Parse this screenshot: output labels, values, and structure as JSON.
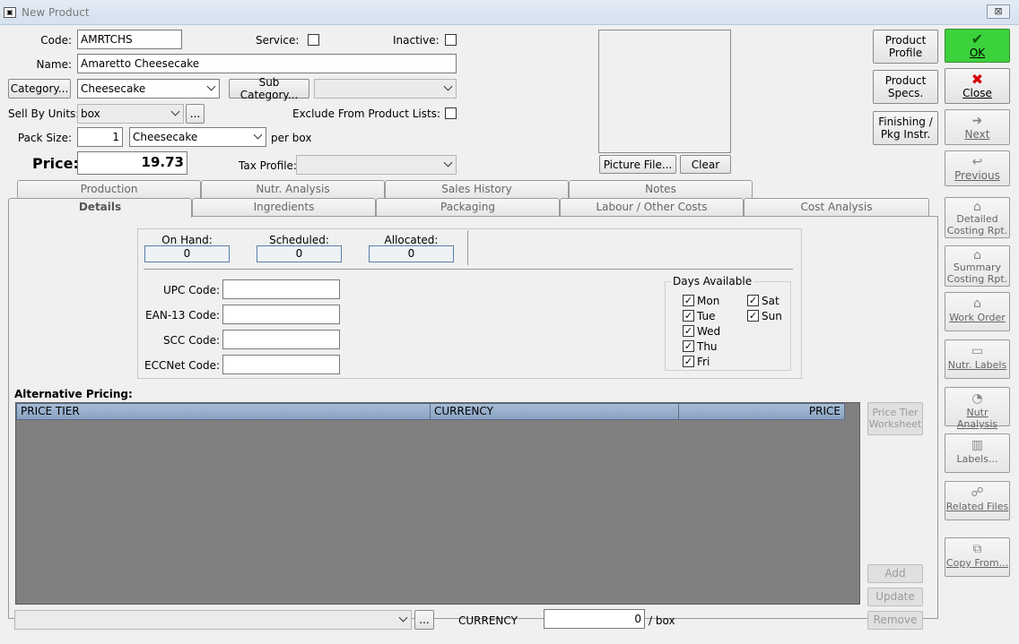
{
  "window": {
    "title": "New Product",
    "close_glyph": "⊠"
  },
  "form": {
    "code_label": "Code:",
    "code_value": "AMRTCHS",
    "service_label": "Service:",
    "inactive_label": "Inactive:",
    "name_label": "Name:",
    "name_value": "Amaretto Cheesecake",
    "category_button": "Category...",
    "category_value": "Cheesecake",
    "subcategory_button": "Sub Category...",
    "subcategory_value": "",
    "sell_by_label": "Sell By Units:",
    "sell_by_value": "box",
    "ellipsis": "...",
    "exclude_label": "Exclude From Product Lists:",
    "pack_size_label": "Pack Size:",
    "pack_size_value": "1",
    "pack_unit_value": "Cheesecake",
    "per_box": "per box",
    "price_label": "Price:",
    "price_value": "19.73",
    "tax_label": "Tax Profile:",
    "tax_value": ""
  },
  "picture": {
    "file_button": "Picture File...",
    "clear_button": "Clear"
  },
  "side_top": {
    "product_profile": [
      "Product",
      "Profile"
    ],
    "product_specs": [
      "Product",
      "Specs."
    ],
    "finishing": [
      "Finishing /",
      "Pkg Instr."
    ]
  },
  "actions": {
    "ok": "OK",
    "close": "Close",
    "next": "Next",
    "previous": "Previous",
    "detailed": [
      "Detailed",
      "Costing Rpt."
    ],
    "summary": [
      "Summary",
      "Costing Rpt."
    ],
    "work_order": "Work Order",
    "nutr_labels": "Nutr. Labels",
    "nutr_analysis": "Nutr Analysis",
    "labels": "Labels...",
    "related_files": "Related Files",
    "copy_from": "Copy From..."
  },
  "tabs_back": [
    "Production",
    "Nutr. Analysis",
    "Sales History",
    "Notes"
  ],
  "tabs_front": [
    "Details",
    "Ingredients",
    "Packaging",
    "Labour / Other Costs",
    "Cost Analysis"
  ],
  "details": {
    "on_hand_label": "On Hand:",
    "on_hand": "0",
    "scheduled_label": "Scheduled:",
    "scheduled": "0",
    "allocated_label": "Allocated:",
    "allocated": "0",
    "upc_label": "UPC Code:",
    "ean_label": "EAN-13 Code:",
    "scc_label": "SCC Code:",
    "eccnet_label": "ECCNet Code:",
    "days_label": "Days Available",
    "days": {
      "mon": "Mon",
      "tue": "Tue",
      "wed": "Wed",
      "thu": "Thu",
      "fri": "Fri",
      "sat": "Sat",
      "sun": "Sun"
    }
  },
  "alt_pricing": {
    "label": "Alternative Pricing:",
    "columns": [
      "PRICE TIER",
      "CURRENCY",
      "PRICE"
    ],
    "rows": [],
    "worksheet_button": [
      "Price Tier",
      "Worksheet"
    ],
    "add": "Add",
    "update": "Update",
    "remove": "Remove",
    "currency_label": "CURRENCY",
    "amount": "0",
    "per_box": "/ box",
    "ellipsis": "..."
  },
  "colors": {
    "ok_green": "#3cd23c",
    "close_x": "#d40000",
    "grid_header": "#9bb2cf",
    "grid_bg": "#808080"
  }
}
